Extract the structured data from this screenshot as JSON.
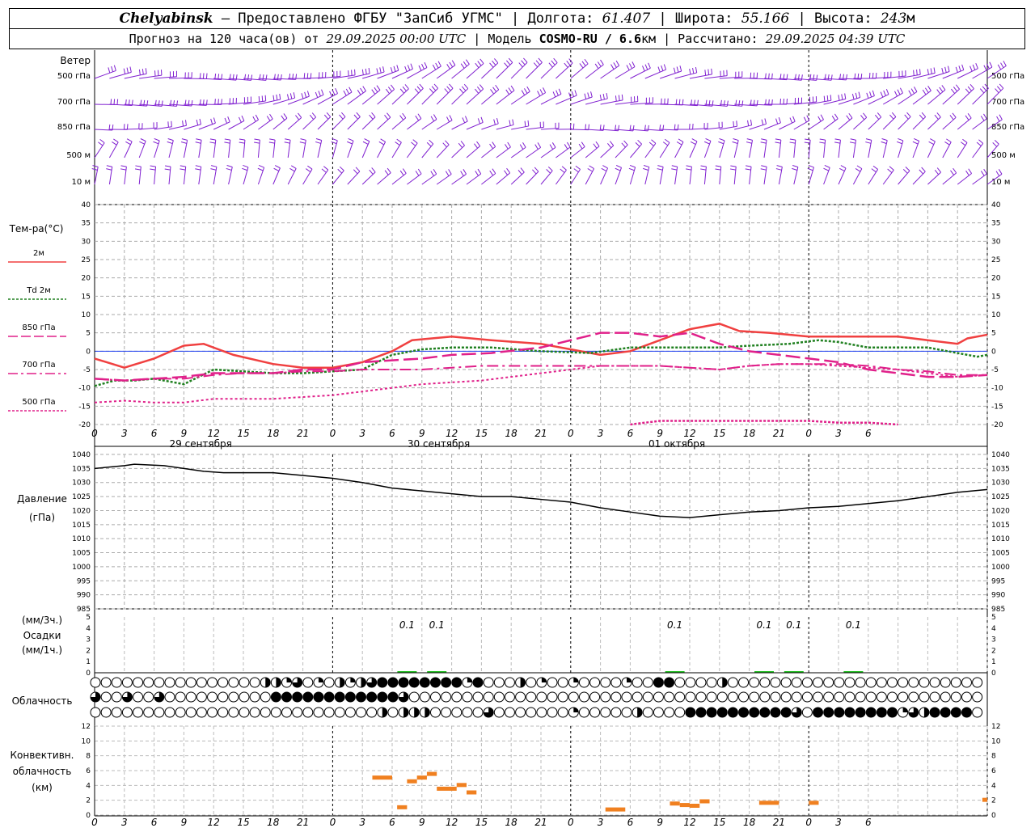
{
  "header": {
    "station": "Chelyabinsk",
    "dash": " – ",
    "provider": "Предоставлено ФГБУ \"ЗапСиб УГМС\"",
    "sep": " | ",
    "lon_label": "Долгота: ",
    "lon_value": "61.407",
    "lat_label": "Широта: ",
    "lat_value": "55.166",
    "alt_label": "Высота: ",
    "alt_value": "243",
    "alt_unit": "м",
    "forecast_prefix": "Прогноз на 120 часа(ов) от ",
    "forecast_start": "29.09.2025 00:00 UTC",
    "model_prefix": " | Модель ",
    "model_name": "COSMO-RU / 6.6",
    "model_unit": "км",
    "calc_prefix": " | Рассчитано: ",
    "calc_time": "29.09.2025 04:39 UTC"
  },
  "labels": {
    "wind": "Ветер",
    "wind_levels": [
      "500 гПа",
      "700 гПа",
      "850 гПа",
      "500 м",
      "10  м"
    ],
    "temp": "Тем-ра(°С)",
    "temp_legend": [
      "2м",
      "Td  2м",
      "850 гПа",
      "700 гПа",
      "500 гПа"
    ],
    "pressure": "Давление",
    "pressure_unit": "(гПа)",
    "precip_top": "(мм/3ч.)",
    "precip": "Осадки",
    "precip_bottom": "(мм/1ч.)",
    "cloud": "Облачность",
    "conv1": "Конвективн.",
    "conv2": "облачность",
    "conv3": "(км)",
    "days": [
      "29 сентября",
      "30 сентября",
      "01 октября"
    ]
  },
  "chart_data": [
    {
      "type": "line",
      "title": "Тем-ра(°С)",
      "x_hours_ticks": [
        "0",
        "3",
        "6",
        "9",
        "12",
        "15",
        "18",
        "21",
        "0",
        "3",
        "6",
        "9",
        "12",
        "15",
        "18",
        "21",
        "0",
        "3",
        "6",
        "9",
        "12",
        "15",
        "18",
        "21",
        "0",
        "3",
        "6"
      ],
      "ylim": [
        -20,
        40
      ],
      "yticks": [
        -20,
        -15,
        -10,
        -5,
        0,
        5,
        10,
        15,
        20,
        25,
        30,
        35,
        40
      ],
      "series": [
        {
          "name": "2м",
          "color": "#f04040",
          "points": [
            [
              0,
              -2
            ],
            [
              3,
              -4.5
            ],
            [
              6,
              -2
            ],
            [
              9,
              1.5
            ],
            [
              11,
              2
            ],
            [
              14,
              -1
            ],
            [
              18,
              -3.5
            ],
            [
              21,
              -4.5
            ],
            [
              24,
              -4.5
            ],
            [
              27,
              -3
            ],
            [
              30,
              0
            ],
            [
              32,
              3
            ],
            [
              36,
              4
            ],
            [
              40,
              3
            ],
            [
              45,
              2
            ],
            [
              51,
              -1
            ],
            [
              54,
              0
            ],
            [
              57,
              3
            ],
            [
              60,
              6
            ],
            [
              63,
              7.5
            ],
            [
              65,
              5.5
            ],
            [
              68,
              5
            ],
            [
              72,
              4
            ],
            [
              75,
              4
            ],
            [
              78,
              4
            ],
            [
              81,
              4
            ],
            [
              84,
              3
            ],
            [
              87,
              2
            ],
            [
              88,
              3.5
            ],
            [
              90,
              4.5
            ]
          ]
        },
        {
          "name": "Td  2м",
          "color": "#208020",
          "points": [
            [
              0,
              -9.5
            ],
            [
              2,
              -8
            ],
            [
              4,
              -8
            ],
            [
              6,
              -7.5
            ],
            [
              9,
              -9
            ],
            [
              12,
              -5
            ],
            [
              15,
              -5.5
            ],
            [
              18,
              -6
            ],
            [
              21,
              -6
            ],
            [
              24,
              -5.5
            ],
            [
              27,
              -5
            ],
            [
              30,
              -1
            ],
            [
              33,
              0.5
            ],
            [
              36,
              1
            ],
            [
              40,
              1
            ],
            [
              45,
              0
            ],
            [
              50,
              -0.5
            ],
            [
              54,
              1
            ],
            [
              57,
              1
            ],
            [
              60,
              1
            ],
            [
              63,
              1
            ],
            [
              66,
              1.5
            ],
            [
              70,
              2
            ],
            [
              73,
              3
            ],
            [
              75,
              2.5
            ],
            [
              78,
              1
            ],
            [
              81,
              1
            ],
            [
              84,
              1
            ],
            [
              87,
              -0.5
            ],
            [
              89,
              -1.5
            ],
            [
              90,
              -1
            ]
          ]
        },
        {
          "name": "850 гПа",
          "color": "#e0208a",
          "points": [
            [
              0,
              -7.5
            ],
            [
              3,
              -8
            ],
            [
              6,
              -7.5
            ],
            [
              9,
              -7
            ],
            [
              12,
              -6
            ],
            [
              15,
              -6
            ],
            [
              18,
              -6
            ],
            [
              21,
              -5
            ],
            [
              24,
              -5
            ],
            [
              27,
              -3
            ],
            [
              33,
              -2
            ],
            [
              36,
              -1
            ],
            [
              40,
              -0.5
            ],
            [
              45,
              1
            ],
            [
              48,
              3
            ],
            [
              51,
              5
            ],
            [
              54,
              5
            ],
            [
              57,
              4
            ],
            [
              60,
              5
            ],
            [
              63,
              2
            ],
            [
              66,
              0
            ],
            [
              69,
              -1
            ],
            [
              72,
              -2
            ],
            [
              75,
              -3
            ],
            [
              78,
              -5
            ],
            [
              81,
              -6
            ],
            [
              84,
              -7
            ],
            [
              87,
              -7
            ],
            [
              90,
              -6.5
            ]
          ]
        },
        {
          "name": "700 гПа",
          "color": "#e0208a",
          "points": [
            [
              0,
              -7.5
            ],
            [
              3,
              -8
            ],
            [
              6,
              -7.5
            ],
            [
              9,
              -7.5
            ],
            [
              12,
              -6.5
            ],
            [
              15,
              -6
            ],
            [
              18,
              -6
            ],
            [
              21,
              -5.5
            ],
            [
              24,
              -5.5
            ],
            [
              27,
              -5
            ],
            [
              30,
              -5
            ],
            [
              33,
              -5
            ],
            [
              36,
              -4.5
            ],
            [
              39,
              -4
            ],
            [
              42,
              -4
            ],
            [
              45,
              -4
            ],
            [
              48,
              -4
            ],
            [
              51,
              -4
            ],
            [
              54,
              -4
            ],
            [
              57,
              -4
            ],
            [
              60,
              -4.5
            ],
            [
              63,
              -5
            ],
            [
              66,
              -4
            ],
            [
              69,
              -3.5
            ],
            [
              72,
              -3.5
            ],
            [
              75,
              -3.5
            ],
            [
              78,
              -4
            ],
            [
              81,
              -5
            ],
            [
              84,
              -5.5
            ],
            [
              87,
              -6.5
            ],
            [
              90,
              -6.5
            ]
          ]
        },
        {
          "name": "500 гПа",
          "color": "#e0208a",
          "points": [
            [
              0,
              -14
            ],
            [
              3,
              -13.5
            ],
            [
              6,
              -14
            ],
            [
              9,
              -14
            ],
            [
              12,
              -13
            ],
            [
              15,
              -13
            ],
            [
              18,
              -13
            ],
            [
              21,
              -12.5
            ],
            [
              24,
              -12
            ],
            [
              27,
              -11
            ],
            [
              30,
              -10
            ],
            [
              33,
              -9
            ],
            [
              36,
              -8.5
            ],
            [
              39,
              -8
            ],
            [
              42,
              -7
            ],
            [
              45,
              -6
            ],
            [
              48,
              -5
            ],
            [
              51,
              -4
            ],
            [
              54,
              -4
            ],
            [
              57,
              -4
            ],
            [
              60,
              -4.5
            ],
            [
              63,
              -5
            ],
            [
              66,
              -4
            ],
            [
              69,
              -3.5
            ],
            [
              72,
              -3.5
            ],
            [
              75,
              -4
            ],
            [
              78,
              -4.5
            ],
            [
              81,
              -5
            ],
            [
              84,
              -6
            ],
            [
              87,
              -7
            ],
            [
              90,
              -6.5
            ]
          ]
        },
        {
          "name": "500 гПа (lower)",
          "color": "#e0208a",
          "points": [
            [
              54,
              -20
            ],
            [
              57,
              -19
            ],
            [
              63,
              -19
            ],
            [
              69,
              -19
            ],
            [
              72,
              -19
            ],
            [
              75,
              -19.5
            ],
            [
              78,
              -19.5
            ],
            [
              81,
              -20
            ]
          ]
        }
      ]
    },
    {
      "type": "line",
      "title": "Давление",
      "ylabel": "(гПа)",
      "ylim": [
        985,
        1040
      ],
      "yticks": [
        985,
        990,
        995,
        1000,
        1005,
        1010,
        1015,
        1020,
        1025,
        1030,
        1035,
        1040
      ],
      "series": [
        {
          "name": "Давление",
          "color": "#000000",
          "points": [
            [
              0,
              1035
            ],
            [
              3,
              1036
            ],
            [
              4,
              1036.5
            ],
            [
              7,
              1036
            ],
            [
              11,
              1034
            ],
            [
              13,
              1033.5
            ],
            [
              18,
              1033.5
            ],
            [
              21,
              1032.5
            ],
            [
              24,
              1031.5
            ],
            [
              27,
              1030
            ],
            [
              30,
              1028
            ],
            [
              33,
              1027
            ],
            [
              36,
              1026
            ],
            [
              39,
              1025
            ],
            [
              42,
              1025
            ],
            [
              45,
              1024
            ],
            [
              48,
              1023
            ],
            [
              51,
              1021
            ],
            [
              54,
              1019.5
            ],
            [
              57,
              1018
            ],
            [
              60,
              1017.5
            ],
            [
              63,
              1018.5
            ],
            [
              66,
              1019.5
            ],
            [
              69,
              1020
            ],
            [
              72,
              1021
            ],
            [
              75,
              1021.5
            ],
            [
              78,
              1022.5
            ],
            [
              81,
              1023.5
            ],
            [
              84,
              1025
            ],
            [
              87,
              1026.5
            ],
            [
              90,
              1027.5
            ]
          ]
        }
      ]
    },
    {
      "type": "bar",
      "title": "Осадки",
      "ylim": [
        0,
        5
      ],
      "yticks": [
        0,
        1,
        2,
        3,
        4,
        5
      ],
      "annotations": [
        {
          "x": 31.5,
          "text": "0.1"
        },
        {
          "x": 34.5,
          "text": "0.1"
        },
        {
          "x": 58.5,
          "text": "0.1"
        },
        {
          "x": 67.5,
          "text": "0.1"
        },
        {
          "x": 70.5,
          "text": "0.1"
        },
        {
          "x": 76.5,
          "text": "0.1"
        }
      ]
    },
    {
      "type": "bar",
      "title": "Конвективн. облачность (км)",
      "ylim": [
        0,
        12
      ],
      "yticks": [
        0,
        2,
        4,
        6,
        8,
        10,
        12
      ],
      "color": "#f08020",
      "bars": [
        {
          "x0": 28,
          "x1": 30,
          "y": 5
        },
        {
          "x0": 30.5,
          "x1": 31.5,
          "y": 1
        },
        {
          "x0": 31.5,
          "x1": 32.5,
          "y": 4.5
        },
        {
          "x0": 32.5,
          "x1": 33.5,
          "y": 5
        },
        {
          "x0": 33.5,
          "x1": 34.5,
          "y": 5.5
        },
        {
          "x0": 34.5,
          "x1": 36.5,
          "y": 3.5
        },
        {
          "x0": 36.5,
          "x1": 37.5,
          "y": 4
        },
        {
          "x0": 37.5,
          "x1": 38.5,
          "y": 3
        },
        {
          "x0": 51.5,
          "x1": 53.5,
          "y": 0.7
        },
        {
          "x0": 58,
          "x1": 59,
          "y": 1.5
        },
        {
          "x0": 59,
          "x1": 60,
          "y": 1.3
        },
        {
          "x0": 60,
          "x1": 61,
          "y": 1.2
        },
        {
          "x0": 61,
          "x1": 62,
          "y": 1.8
        },
        {
          "x0": 67,
          "x1": 69,
          "y": 1.6
        },
        {
          "x0": 72,
          "x1": 73,
          "y": 1.6
        },
        {
          "x0": 89.5,
          "x1": 90,
          "y": 2
        }
      ]
    }
  ],
  "clouds": {
    "rows": [
      "000000000000000022130102123444444441400020100100001004400002000000000000000000000000",
      "300300300000000004444444444443000000000000000000000000000000000000000000000000000000",
      "000000000000000000000000000202220000030000000100000200004444444444304444444413244440"
    ]
  }
}
